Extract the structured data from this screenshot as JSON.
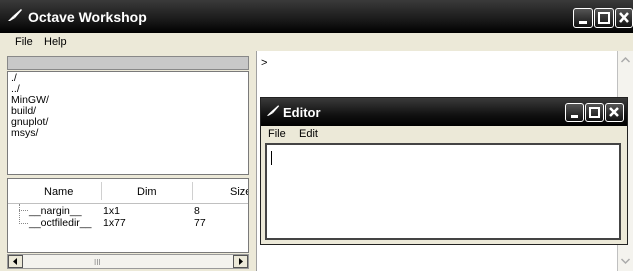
{
  "window": {
    "title": "Octave Workshop"
  },
  "menubar": {
    "items": [
      "File",
      "Help"
    ]
  },
  "file_browser": {
    "current_dir": "",
    "entries": [
      "./",
      "../",
      "MinGW/",
      "build/",
      "gnuplot/",
      "msys/"
    ]
  },
  "variables": {
    "columns": [
      "Name",
      "Dim",
      "Size"
    ],
    "rows": [
      {
        "name": "__nargin__",
        "dim": "1x1",
        "size": "8"
      },
      {
        "name": "__octfiledir__",
        "dim": "1x77",
        "size": "77"
      }
    ],
    "scroll_grip": "III"
  },
  "console": {
    "prompt": ">"
  },
  "editor": {
    "title": "Editor",
    "menu": [
      "File",
      "Edit"
    ],
    "text": ""
  },
  "colors": {
    "titlebar": "#000000",
    "chrome": "#ece9d8"
  },
  "icons": {
    "app": "brush-icon",
    "minimize": "minimize-icon",
    "maximize": "maximize-icon",
    "close": "close-icon"
  }
}
